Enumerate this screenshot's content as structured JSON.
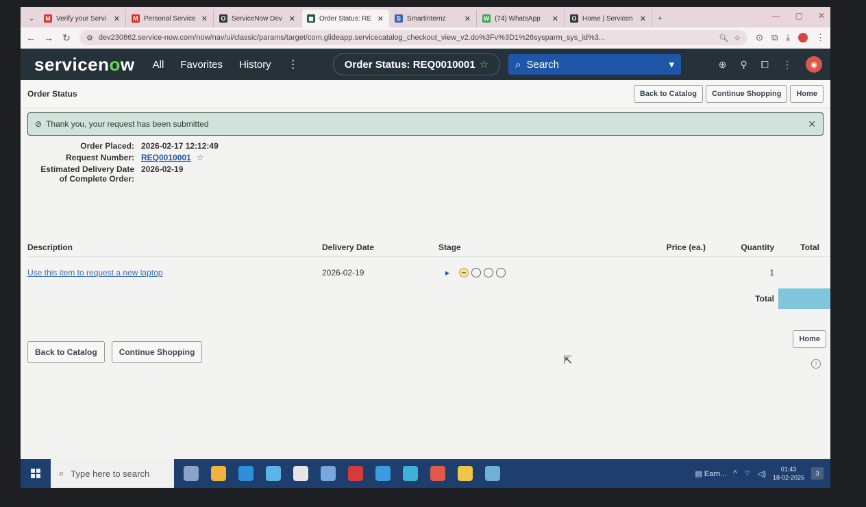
{
  "browser": {
    "tabs": [
      {
        "title": "Verify your Servi",
        "icon": "gmail-icon",
        "color": "#d93025",
        "glyph": "M"
      },
      {
        "title": "Personal Service",
        "icon": "gmail-icon",
        "color": "#d93025",
        "glyph": "M"
      },
      {
        "title": "ServiceNow Dev",
        "icon": "servicenow-icon",
        "color": "#2b3a42",
        "glyph": "O"
      },
      {
        "title": "Order Status: RE",
        "icon": "servicenow-icon",
        "color": "#1b5e3b",
        "glyph": "◼",
        "active": true
      },
      {
        "title": "Smartinternz",
        "icon": "smartinternz-icon",
        "color": "#3566b5",
        "glyph": "S"
      },
      {
        "title": "(74) WhatsApp",
        "icon": "whatsapp-icon",
        "color": "#3aa657",
        "glyph": "W"
      },
      {
        "title": "Home | Servicen",
        "icon": "servicenow-icon",
        "color": "#2b3a42",
        "glyph": "O"
      }
    ],
    "new_tab": "+",
    "url": "dev230862.service-now.com/now/nav/ui/classic/params/target/com.glideapp.servicecatalog_checkout_view_v2.do%3Fv%3D1%26sysparm_sys_id%3..."
  },
  "header": {
    "logo_pre": "servicen",
    "logo_o": "o",
    "logo_post": "w",
    "nav": {
      "all": "All",
      "favorites": "Favorites",
      "history": "History"
    },
    "more": "⋮",
    "context_title": "Order Status: REQ0010001",
    "search_label": "Search"
  },
  "page": {
    "title": "Order Status",
    "buttons": {
      "back": "Back to Catalog",
      "continue": "Continue Shopping",
      "home": "Home"
    },
    "alert": "Thank you, your request has been submitted",
    "order_placed_label": "Order Placed:",
    "order_placed": "2026-02-17 12:12:49",
    "request_number_label": "Request Number:",
    "request_number": "REQ0010001",
    "est_delivery_label_1": "Estimated Delivery Date",
    "est_delivery_label_2": "of Complete Order:",
    "est_delivery": "2026-02-19"
  },
  "table": {
    "headers": {
      "description": "Description",
      "delivery": "Delivery Date",
      "stage": "Stage",
      "price": "Price (ea.)",
      "quantity": "Quantity",
      "total": "Total"
    },
    "rows": [
      {
        "description": "Use this item to request a new laptop",
        "delivery": "2026-02-19",
        "quantity": "1",
        "stages_total": 4,
        "stage_current": 1
      }
    ],
    "total_label": "Total"
  },
  "taskbar": {
    "search_placeholder": "Type here to search",
    "app_colors": [
      "#8aa4c8",
      "#f2b33d",
      "#2f8fd8",
      "#5bb3e8",
      "#e6e6e6",
      "#7aa6e0",
      "#d63a3a",
      "#3a9be0",
      "#3fb0d8",
      "#e05a4a",
      "#f0c64a",
      "#6fb0d8"
    ],
    "pinned_doc": "Earn...",
    "time": "01:43",
    "date": "18-02-2026",
    "notifications": "3"
  }
}
